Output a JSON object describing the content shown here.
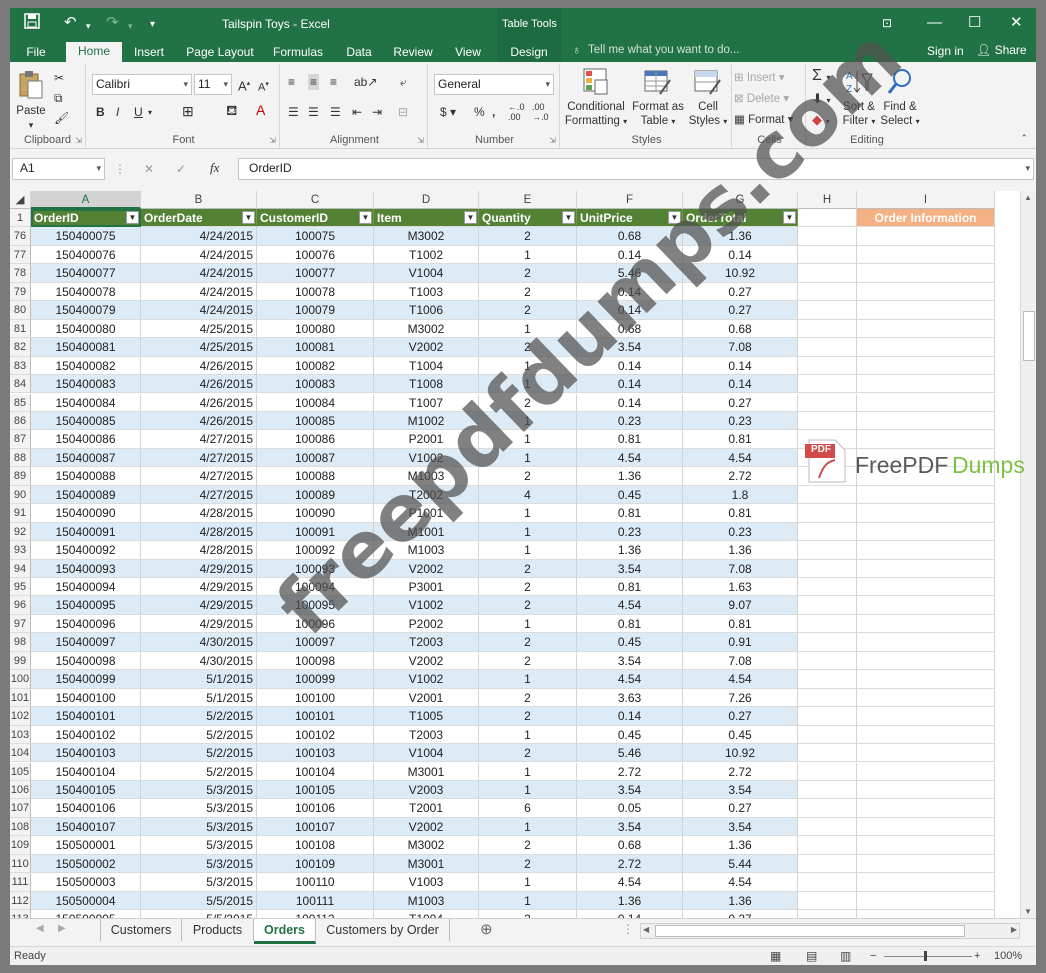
{
  "title": "Tailspin Toys - Excel",
  "table_tools": "Table Tools",
  "tabs": [
    "File",
    "Home",
    "Insert",
    "Page Layout",
    "Formulas",
    "Data",
    "Review",
    "View",
    "Design"
  ],
  "tell_me": "Tell me what you want to do...",
  "sign_in": "Sign in",
  "share": "Share",
  "clipboard": {
    "paste": "Paste",
    "label": "Clipboard"
  },
  "font": {
    "name": "Calibri",
    "size": "11",
    "label": "Font"
  },
  "alignment": {
    "label": "Alignment"
  },
  "number": {
    "format": "General",
    "label": "Number"
  },
  "styles": {
    "conditional": "Conditional",
    "formatting": "Formatting",
    "format_as": "Format as",
    "table": "Table",
    "cell": "Cell",
    "cell_styles": "Styles",
    "label": "Styles"
  },
  "cells": {
    "insert": "Insert",
    "delete": "Delete",
    "format": "Format",
    "label": "Cells"
  },
  "editing": {
    "sort": "Sort &",
    "filter": "Filter",
    "find": "Find &",
    "select": "Select",
    "label": "Editing"
  },
  "namebox": "A1",
  "formula": "OrderID",
  "col_letters": [
    "A",
    "B",
    "C",
    "D",
    "E",
    "F",
    "G",
    "H",
    "I"
  ],
  "headers": [
    "OrderID",
    "OrderDate",
    "CustomerID",
    "Item",
    "Quantity",
    "UnitPrice",
    "OrderTotal"
  ],
  "order_info": "Order Information",
  "rows": [
    [
      "76",
      "150400075",
      "4/24/2015",
      "100075",
      "M3002",
      "2",
      "0.68",
      "1.36"
    ],
    [
      "77",
      "150400076",
      "4/24/2015",
      "100076",
      "T1002",
      "1",
      "0.14",
      "0.14"
    ],
    [
      "78",
      "150400077",
      "4/24/2015",
      "100077",
      "V1004",
      "2",
      "5.46",
      "10.92"
    ],
    [
      "79",
      "150400078",
      "4/24/2015",
      "100078",
      "T1003",
      "2",
      "0.14",
      "0.27"
    ],
    [
      "80",
      "150400079",
      "4/24/2015",
      "100079",
      "T1006",
      "2",
      "0.14",
      "0.27"
    ],
    [
      "81",
      "150400080",
      "4/25/2015",
      "100080",
      "M3002",
      "1",
      "0.68",
      "0.68"
    ],
    [
      "82",
      "150400081",
      "4/25/2015",
      "100081",
      "V2002",
      "2",
      "3.54",
      "7.08"
    ],
    [
      "83",
      "150400082",
      "4/26/2015",
      "100082",
      "T1004",
      "1",
      "0.14",
      "0.14"
    ],
    [
      "84",
      "150400083",
      "4/26/2015",
      "100083",
      "T1008",
      "1",
      "0.14",
      "0.14"
    ],
    [
      "85",
      "150400084",
      "4/26/2015",
      "100084",
      "T1007",
      "2",
      "0.14",
      "0.27"
    ],
    [
      "86",
      "150400085",
      "4/26/2015",
      "100085",
      "M1002",
      "1",
      "0.23",
      "0.23"
    ],
    [
      "87",
      "150400086",
      "4/27/2015",
      "100086",
      "P2001",
      "1",
      "0.81",
      "0.81"
    ],
    [
      "88",
      "150400087",
      "4/27/2015",
      "100087",
      "V1002",
      "1",
      "4.54",
      "4.54"
    ],
    [
      "89",
      "150400088",
      "4/27/2015",
      "100088",
      "M1003",
      "2",
      "1.36",
      "2.72"
    ],
    [
      "90",
      "150400089",
      "4/27/2015",
      "100089",
      "T2002",
      "4",
      "0.45",
      "1.8"
    ],
    [
      "91",
      "150400090",
      "4/28/2015",
      "100090",
      "P1001",
      "1",
      "0.81",
      "0.81"
    ],
    [
      "92",
      "150400091",
      "4/28/2015",
      "100091",
      "M1001",
      "1",
      "0.23",
      "0.23"
    ],
    [
      "93",
      "150400092",
      "4/28/2015",
      "100092",
      "M1003",
      "1",
      "1.36",
      "1.36"
    ],
    [
      "94",
      "150400093",
      "4/29/2015",
      "100093",
      "V2002",
      "2",
      "3.54",
      "7.08"
    ],
    [
      "95",
      "150400094",
      "4/29/2015",
      "100094",
      "P3001",
      "2",
      "0.81",
      "1.63"
    ],
    [
      "96",
      "150400095",
      "4/29/2015",
      "100095",
      "V1002",
      "2",
      "4.54",
      "9.07"
    ],
    [
      "97",
      "150400096",
      "4/29/2015",
      "100096",
      "P2002",
      "1",
      "0.81",
      "0.81"
    ],
    [
      "98",
      "150400097",
      "4/30/2015",
      "100097",
      "T2003",
      "2",
      "0.45",
      "0.91"
    ],
    [
      "99",
      "150400098",
      "4/30/2015",
      "100098",
      "V2002",
      "2",
      "3.54",
      "7.08"
    ],
    [
      "100",
      "150400099",
      "5/1/2015",
      "100099",
      "V1002",
      "1",
      "4.54",
      "4.54"
    ],
    [
      "101",
      "150400100",
      "5/1/2015",
      "100100",
      "V2001",
      "2",
      "3.63",
      "7.26"
    ],
    [
      "102",
      "150400101",
      "5/2/2015",
      "100101",
      "T1005",
      "2",
      "0.14",
      "0.27"
    ],
    [
      "103",
      "150400102",
      "5/2/2015",
      "100102",
      "T2003",
      "1",
      "0.45",
      "0.45"
    ],
    [
      "104",
      "150400103",
      "5/2/2015",
      "100103",
      "V1004",
      "2",
      "5.46",
      "10.92"
    ],
    [
      "105",
      "150400104",
      "5/2/2015",
      "100104",
      "M3001",
      "1",
      "2.72",
      "2.72"
    ],
    [
      "106",
      "150400105",
      "5/3/2015",
      "100105",
      "V2003",
      "1",
      "3.54",
      "3.54"
    ],
    [
      "107",
      "150400106",
      "5/3/2015",
      "100106",
      "T2001",
      "6",
      "0.05",
      "0.27"
    ],
    [
      "108",
      "150400107",
      "5/3/2015",
      "100107",
      "V2002",
      "1",
      "3.54",
      "3.54"
    ],
    [
      "109",
      "150500001",
      "5/3/2015",
      "100108",
      "M3002",
      "2",
      "0.68",
      "1.36"
    ],
    [
      "110",
      "150500002",
      "5/3/2015",
      "100109",
      "M3001",
      "2",
      "2.72",
      "5.44"
    ],
    [
      "111",
      "150500003",
      "5/3/2015",
      "100110",
      "V1003",
      "1",
      "4.54",
      "4.54"
    ],
    [
      "112",
      "150500004",
      "5/5/2015",
      "100111",
      "M1003",
      "1",
      "1.36",
      "1.36"
    ],
    [
      "113",
      "150500005",
      "5/5/2015",
      "100112",
      "T1004",
      "2",
      "0.14",
      "0.27"
    ]
  ],
  "sheets": [
    "Customers",
    "Products",
    "Orders",
    "Customers by Order"
  ],
  "status": "Ready",
  "zoom": "100%",
  "watermark": "freepdfdumps.com",
  "logo": {
    "pdf": "PDF",
    "free": "FreePDF",
    "dumps": "Dumps"
  }
}
